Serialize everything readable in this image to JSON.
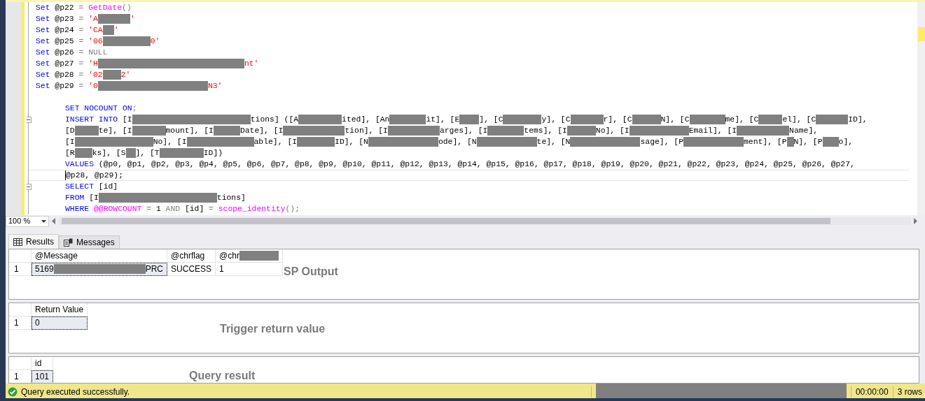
{
  "editor": {
    "lines": [
      {
        "indented": false,
        "fold": false,
        "current": false,
        "tokens": [
          {
            "kind": "keyword",
            "text": "Set"
          },
          {
            "kind": "plain",
            "text": " @p22 "
          },
          {
            "kind": "operator",
            "text": "= "
          },
          {
            "kind": "function",
            "text": "GetDate"
          },
          {
            "kind": "operator",
            "text": "()"
          }
        ]
      },
      {
        "indented": false,
        "fold": false,
        "current": false,
        "tokens": [
          {
            "kind": "keyword",
            "text": "Set"
          },
          {
            "kind": "plain",
            "text": " @p23 "
          },
          {
            "kind": "operator",
            "text": "= "
          },
          {
            "kind": "string",
            "text": "'A"
          },
          {
            "kind": "redacted"
          },
          {
            "kind": "string",
            "text": "'"
          }
        ]
      },
      {
        "indented": false,
        "fold": false,
        "current": false,
        "tokens": [
          {
            "kind": "keyword",
            "text": "Set"
          },
          {
            "kind": "plain",
            "text": " @p24 "
          },
          {
            "kind": "operator",
            "text": "= "
          },
          {
            "kind": "string",
            "text": "'CA"
          },
          {
            "kind": "redacted"
          },
          {
            "kind": "string",
            "text": "'"
          }
        ]
      },
      {
        "indented": false,
        "fold": false,
        "current": false,
        "tokens": [
          {
            "kind": "keyword",
            "text": "Set"
          },
          {
            "kind": "plain",
            "text": " @p25 "
          },
          {
            "kind": "operator",
            "text": "= "
          },
          {
            "kind": "string",
            "text": "'06"
          },
          {
            "kind": "redacted"
          },
          {
            "kind": "string",
            "text": "0'"
          }
        ]
      },
      {
        "indented": false,
        "fold": false,
        "current": false,
        "tokens": [
          {
            "kind": "keyword",
            "text": "Set"
          },
          {
            "kind": "plain",
            "text": " @p26 "
          },
          {
            "kind": "operator",
            "text": "= NULL"
          }
        ]
      },
      {
        "indented": false,
        "fold": false,
        "current": false,
        "tokens": [
          {
            "kind": "keyword",
            "text": "Set"
          },
          {
            "kind": "plain",
            "text": " @p27 "
          },
          {
            "kind": "operator",
            "text": "= "
          },
          {
            "kind": "string",
            "text": "'H"
          },
          {
            "kind": "redacted"
          },
          {
            "kind": "string",
            "text": "nt'"
          }
        ]
      },
      {
        "indented": false,
        "fold": false,
        "current": false,
        "tokens": [
          {
            "kind": "keyword",
            "text": "Set"
          },
          {
            "kind": "plain",
            "text": " @p28 "
          },
          {
            "kind": "operator",
            "text": "= "
          },
          {
            "kind": "string",
            "text": "'02"
          },
          {
            "kind": "redacted"
          },
          {
            "kind": "string",
            "text": "2'"
          }
        ]
      },
      {
        "indented": false,
        "fold": false,
        "current": false,
        "tokens": [
          {
            "kind": "keyword",
            "text": "Set"
          },
          {
            "kind": "plain",
            "text": " @p29 "
          },
          {
            "kind": "operator",
            "text": "= "
          },
          {
            "kind": "string",
            "text": "'0"
          },
          {
            "kind": "redacted"
          },
          {
            "kind": "string",
            "text": "N3'"
          }
        ]
      },
      {
        "fold": false,
        "current": false
      },
      {
        "indented": true,
        "fold": false,
        "current": false,
        "tokens": [
          {
            "kind": "keyword",
            "text": "SET NOCOUNT ON"
          },
          {
            "kind": "operator",
            "text": ";"
          }
        ]
      },
      {
        "indented": true,
        "fold": true,
        "current": false,
        "tokens": [
          {
            "kind": "keyword",
            "text": "INSERT INTO"
          },
          {
            "kind": "plain",
            "text": " [I"
          },
          {
            "kind": "redacted"
          },
          {
            "kind": "plain",
            "text": "tions] ([A"
          },
          {
            "kind": "redacted"
          },
          {
            "kind": "plain",
            "text": "ited], [An"
          },
          {
            "kind": "redacted"
          },
          {
            "kind": "plain",
            "text": "it], [E"
          },
          {
            "kind": "redacted"
          },
          {
            "kind": "plain",
            "text": "], [C"
          },
          {
            "kind": "redacted"
          },
          {
            "kind": "plain",
            "text": "y], [C"
          },
          {
            "kind": "redacted"
          },
          {
            "kind": "plain",
            "text": "r], [C"
          },
          {
            "kind": "redacted"
          },
          {
            "kind": "plain",
            "text": "N], [C"
          },
          {
            "kind": "redacted"
          },
          {
            "kind": "plain",
            "text": "me], [C"
          },
          {
            "kind": "redacted"
          },
          {
            "kind": "plain",
            "text": "el], [C"
          },
          {
            "kind": "redacted"
          },
          {
            "kind": "plain",
            "text": "ID],"
          }
        ]
      },
      {
        "indented": true,
        "fold": false,
        "current": false,
        "tokens": [
          {
            "kind": "plain",
            "text": "[D"
          },
          {
            "kind": "redacted"
          },
          {
            "kind": "plain",
            "text": "te], [I"
          },
          {
            "kind": "redacted"
          },
          {
            "kind": "plain",
            "text": "mount], [I"
          },
          {
            "kind": "redacted"
          },
          {
            "kind": "plain",
            "text": "Date], [I"
          },
          {
            "kind": "redacted"
          },
          {
            "kind": "plain",
            "text": "tion], [I"
          },
          {
            "kind": "redacted"
          },
          {
            "kind": "plain",
            "text": "arges], [I"
          },
          {
            "kind": "redacted"
          },
          {
            "kind": "plain",
            "text": "tems], [I"
          },
          {
            "kind": "redacted"
          },
          {
            "kind": "plain",
            "text": "No], [I"
          },
          {
            "kind": "redacted"
          },
          {
            "kind": "plain",
            "text": "Email], [I"
          },
          {
            "kind": "redacted"
          },
          {
            "kind": "plain",
            "text": "Name],"
          }
        ]
      },
      {
        "indented": true,
        "fold": false,
        "current": false,
        "tokens": [
          {
            "kind": "plain",
            "text": "[I"
          },
          {
            "kind": "redacted"
          },
          {
            "kind": "plain",
            "text": "No], [I"
          },
          {
            "kind": "redacted"
          },
          {
            "kind": "plain",
            "text": "able], [I"
          },
          {
            "kind": "redacted"
          },
          {
            "kind": "plain",
            "text": "ID], [N"
          },
          {
            "kind": "redacted"
          },
          {
            "kind": "plain",
            "text": "ode], [N"
          },
          {
            "kind": "redacted"
          },
          {
            "kind": "plain",
            "text": "te], [N"
          },
          {
            "kind": "redacted"
          },
          {
            "kind": "plain",
            "text": "sage], [P"
          },
          {
            "kind": "redacted"
          },
          {
            "kind": "plain",
            "text": "ment], [P"
          },
          {
            "kind": "redacted"
          },
          {
            "kind": "plain",
            "text": "N], [P"
          },
          {
            "kind": "redacted"
          },
          {
            "kind": "plain",
            "text": "o],"
          }
        ]
      },
      {
        "indented": true,
        "fold": false,
        "current": false,
        "tokens": [
          {
            "kind": "plain",
            "text": "[R"
          },
          {
            "kind": "redacted"
          },
          {
            "kind": "plain",
            "text": "ks], [S"
          },
          {
            "kind": "redacted"
          },
          {
            "kind": "plain",
            "text": "], [T"
          },
          {
            "kind": "redacted"
          },
          {
            "kind": "plain",
            "text": "ID])"
          }
        ]
      },
      {
        "indented": true,
        "fold": false,
        "current": false,
        "tokens": [
          {
            "kind": "keyword",
            "text": "VALUES"
          },
          {
            "kind": "plain",
            "text": " (@p0, @p1, @p2, @p3, @p4, @p5, @p6, @p7, @p8, @p9, @p10, @p11, @p12, @p13, @p14, @p15, @p16, @p17, @p18, @p19, @p20, @p21, @p22, @p23, @p24, @p25, @p26, @p27,"
          }
        ]
      },
      {
        "indented": true,
        "fold": false,
        "current": true,
        "tokens": [
          {
            "kind": "plain",
            "text": "@p28, @p29);"
          }
        ]
      },
      {
        "indented": true,
        "fold": true,
        "current": false,
        "tokens": [
          {
            "kind": "keyword",
            "text": "SELECT"
          },
          {
            "kind": "plain",
            "text": " [id]"
          }
        ]
      },
      {
        "indented": true,
        "fold": false,
        "current": false,
        "tokens": [
          {
            "kind": "keyword",
            "text": "FROM"
          },
          {
            "kind": "plain",
            "text": " [I"
          },
          {
            "kind": "redacted"
          },
          {
            "kind": "plain",
            "text": "tions]"
          }
        ]
      },
      {
        "indented": true,
        "fold": false,
        "current": false,
        "tokens": [
          {
            "kind": "keyword",
            "text": "WHERE "
          },
          {
            "kind": "function",
            "text": "@@ROWCOUNT"
          },
          {
            "kind": "operator",
            "text": " ="
          },
          {
            "kind": "plain",
            "text": " 1 "
          },
          {
            "kind": "operator",
            "text": "AND"
          },
          {
            "kind": "plain",
            "text": " [id] "
          },
          {
            "kind": "operator",
            "text": "= "
          },
          {
            "kind": "function",
            "text": "scope_identity"
          },
          {
            "kind": "operator",
            "text": "();"
          }
        ]
      }
    ]
  },
  "zoom_level": "100 %",
  "result_tabs": [
    {
      "label": "Results",
      "selected": true
    },
    {
      "label": "Messages",
      "selected": false
    }
  ],
  "result_grids": [
    {
      "columns": [
        "",
        [
          {
            "kind": "plain",
            "text": "@Message"
          }
        ],
        [
          {
            "kind": "plain",
            "text": "@chrflag"
          }
        ],
        [
          {
            "kind": "plain",
            "text": "@chr"
          },
          {
            "kind": "redacted"
          }
        ]
      ],
      "rows": [
        {
          "cells": [
            {
              "kind": "row_number",
              "tokens": [
                {
                  "kind": "plain",
                  "text": "1"
                }
              ]
            },
            {
              "selected": true,
              "tokens": [
                {
                  "kind": "plain",
                  "text": "5169"
                },
                {
                  "kind": "redacted"
                },
                {
                  "kind": "plain",
                  "text": "PRC"
                }
              ]
            },
            {
              "selected": false,
              "tokens": [
                {
                  "kind": "plain",
                  "text": "SUCCESS"
                }
              ]
            },
            {
              "selected": false,
              "tokens": [
                {
                  "kind": "plain",
                  "text": "1"
                }
              ]
            }
          ]
        }
      ],
      "annotation": "SP Output"
    },
    {
      "columns": [
        "",
        [
          {
            "kind": "plain",
            "text": "Return Value"
          }
        ]
      ],
      "rows": [
        {
          "cells": [
            {
              "kind": "row_number",
              "tokens": [
                {
                  "kind": "plain",
                  "text": "1"
                }
              ]
            },
            {
              "selected": true,
              "tokens": [
                {
                  "kind": "plain",
                  "text": "0"
                }
              ]
            }
          ]
        }
      ],
      "annotation": "Trigger return value"
    },
    {
      "columns": [
        "",
        [
          {
            "kind": "plain",
            "text": "id"
          }
        ]
      ],
      "rows": [
        {
          "cells": [
            {
              "kind": "row_number",
              "tokens": [
                {
                  "kind": "plain",
                  "text": "1"
                }
              ]
            },
            {
              "selected": true,
              "tokens": [
                {
                  "kind": "plain",
                  "text": "101"
                }
              ]
            }
          ]
        }
      ],
      "annotation": "Query result"
    }
  ],
  "status_bar": {
    "message": "Query executed successfully.",
    "redacted": true,
    "elapsed": "00:00:00",
    "row_count": "3 rows"
  }
}
